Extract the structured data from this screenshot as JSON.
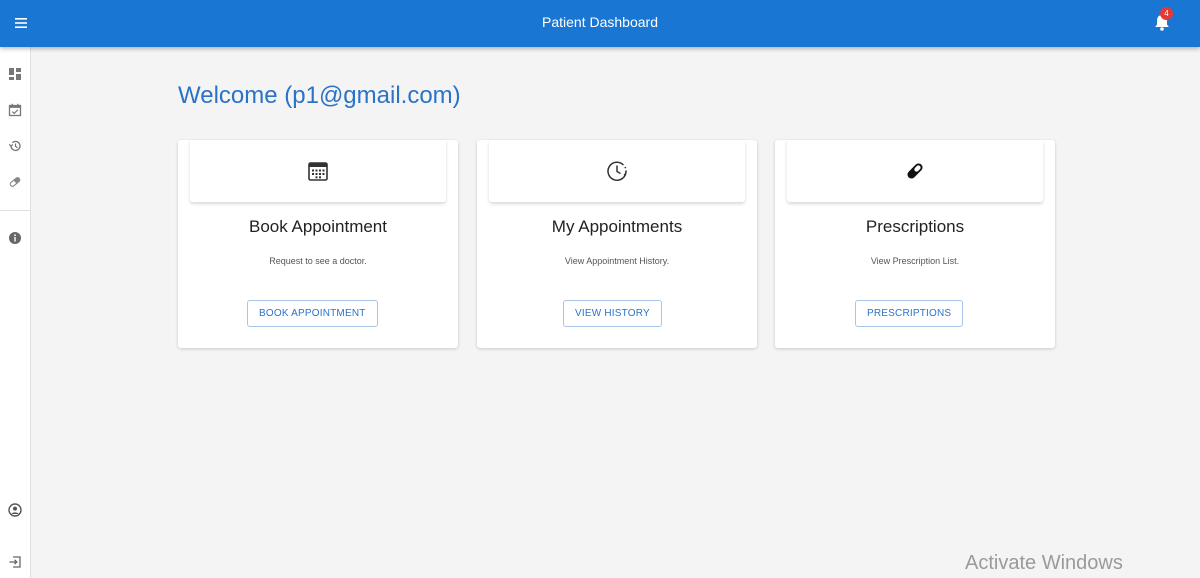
{
  "header": {
    "title": "Patient Dashboard",
    "menu_icon": "menu-icon",
    "notification_icon": "bell-icon",
    "notification_count": "4",
    "bar_color": "#1976d2",
    "badge_color": "#e53935"
  },
  "sidebar": {
    "items": [
      {
        "icon": "dashboard-icon"
      },
      {
        "icon": "calendar-check-icon"
      },
      {
        "icon": "history-icon"
      },
      {
        "icon": "pill-icon"
      },
      {
        "icon": "info-icon"
      },
      {
        "icon": "account-icon"
      },
      {
        "icon": "logout-icon"
      }
    ]
  },
  "main": {
    "welcome": "Welcome (p1@gmail.com)",
    "accent_color": "#2a73c7",
    "cards": [
      {
        "icon": "calendar-grid-icon",
        "title": "Book Appointment",
        "description": "Request to see a doctor.",
        "button": "BOOK APPOINTMENT"
      },
      {
        "icon": "clock-icon",
        "title": "My Appointments",
        "description": "View Appointment History.",
        "button": "VIEW HISTORY"
      },
      {
        "icon": "pill-icon",
        "title": "Prescriptions",
        "description": "View Prescription List.",
        "button": "PRESCRIPTIONS"
      }
    ]
  },
  "overlay": {
    "watermark": "Activate Windows"
  }
}
